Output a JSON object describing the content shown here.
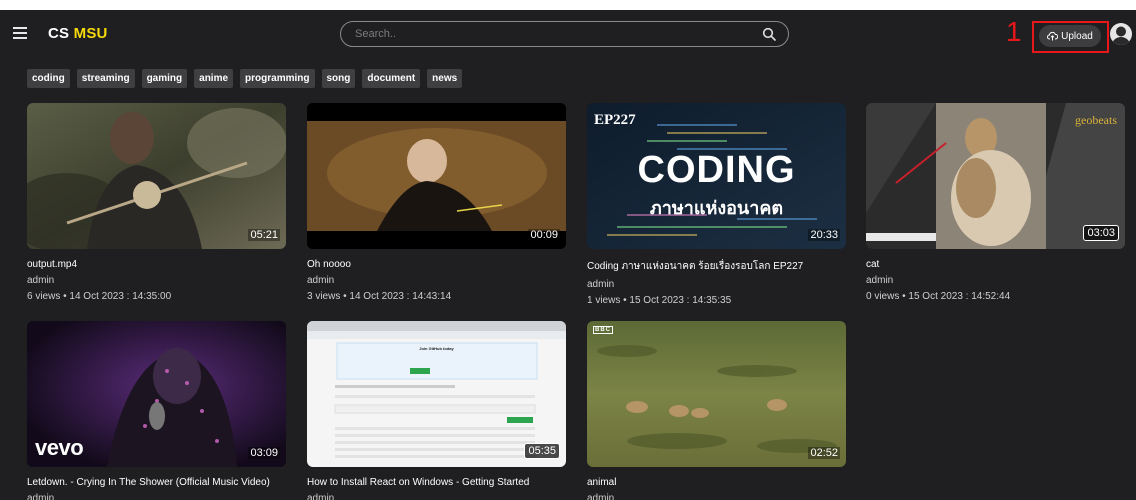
{
  "header": {
    "brand_cs": "CS",
    "brand_msu": "MSU",
    "search_placeholder": "Search..",
    "upload_label": "Upload",
    "step_number": "1"
  },
  "categories": [
    "coding",
    "streaming",
    "gaming",
    "anime",
    "programming",
    "song",
    "document",
    "news"
  ],
  "videos": [
    {
      "title": "output.mp4",
      "author": "admin",
      "meta": "6 views • 14 Oct 2023 : 14:35:00",
      "duration": "05:21"
    },
    {
      "title": "Oh noooo",
      "author": "admin",
      "meta": "3 views • 14 Oct 2023 : 14:43:14",
      "duration": "00:09"
    },
    {
      "title": "Coding ภาษาแห่งอนาคต ร้อยเรื่องรอบโลก EP227",
      "author": "admin",
      "meta": "1 views • 15 Oct 2023 : 14:35:35",
      "duration": "20:33",
      "thumb_ep": "EP227",
      "thumb_big": "CODING",
      "thumb_thai": "ภาษาแห่งอนาคต"
    },
    {
      "title": "cat",
      "author": "admin",
      "meta": "0 views • 15 Oct 2023 : 14:52:44",
      "duration": "03:03",
      "thumb_brand": "geobeats"
    },
    {
      "title": "Letdown. - Crying In The Shower (Official Music Video)",
      "author": "admin",
      "meta": "",
      "duration": "03:09",
      "thumb_brand": "vevo"
    },
    {
      "title": "How to Install React on Windows - Getting Started",
      "author": "admin",
      "meta": "",
      "duration": "05:35",
      "thumb_heading": "Join GitHub today"
    },
    {
      "title": "animal",
      "author": "admin",
      "meta": "",
      "duration": "02:52",
      "thumb_brand": "BBC"
    }
  ],
  "colors": {
    "accent": "#f5d90a",
    "highlight": "#e8171a",
    "background": "#1f1f21"
  }
}
